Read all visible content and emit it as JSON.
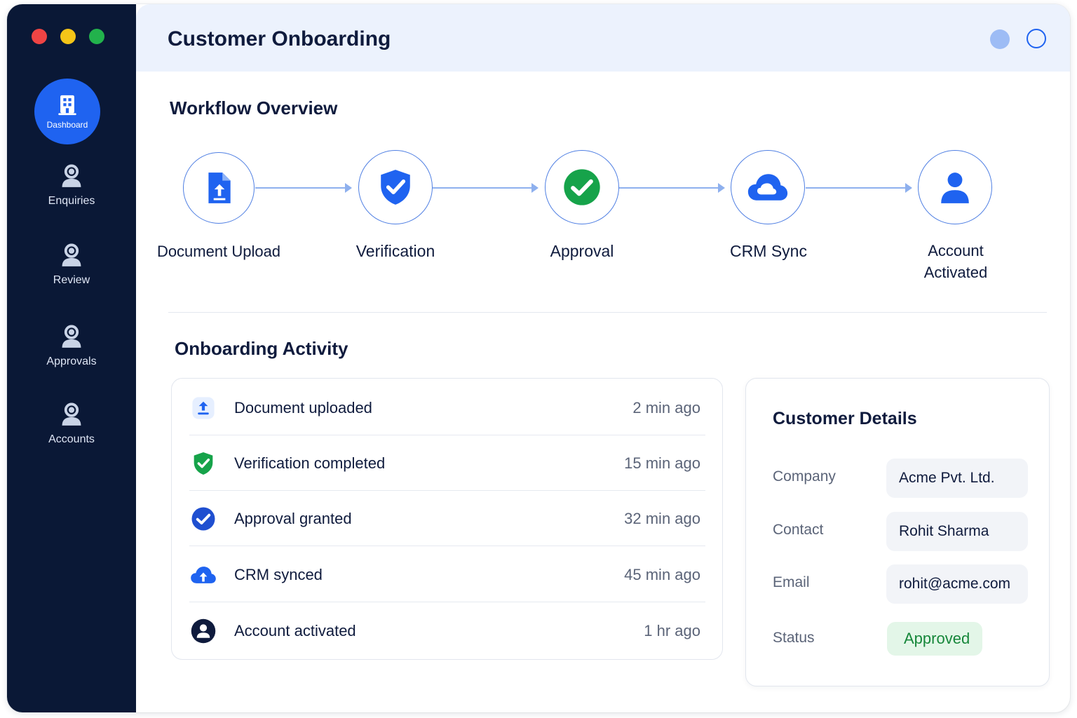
{
  "sidebar": {
    "items": [
      {
        "label": "Dashboard",
        "icon": "building-icon",
        "active": true
      },
      {
        "label": "Enquiries",
        "icon": "user-icon"
      },
      {
        "label": "Review",
        "icon": "user-icon"
      },
      {
        "label": "Approvals",
        "icon": "user-icon"
      },
      {
        "label": "Accounts",
        "icon": "user-icon"
      }
    ]
  },
  "header": {
    "title": "Customer Onboarding"
  },
  "workflow": {
    "title": "Workflow Overview",
    "steps": [
      {
        "label": "Document Upload",
        "icon": "document-upload-icon"
      },
      {
        "label": "Verification",
        "icon": "shield-check-icon"
      },
      {
        "label": "Approval",
        "icon": "check-circle-icon"
      },
      {
        "label": "CRM Sync",
        "icon": "cloud-icon"
      },
      {
        "label": "Account Activated",
        "icon": "user-icon"
      }
    ]
  },
  "activity": {
    "title": "Onboarding Activity",
    "items": [
      {
        "text": "Document uploaded",
        "time": "2 min ago",
        "icon": "upload-icon"
      },
      {
        "text": "Verification completed",
        "time": "15 min ago",
        "icon": "shield-check-icon"
      },
      {
        "text": "Approval granted",
        "time": "32 min ago",
        "icon": "check-circle-icon"
      },
      {
        "text": "CRM synced",
        "time": "45 min ago",
        "icon": "cloud-upload-icon"
      },
      {
        "text": "Account activated",
        "time": "1 hr ago",
        "icon": "user-circle-icon"
      }
    ]
  },
  "customer": {
    "title": "Customer Details",
    "fields": [
      {
        "label": "Company",
        "value": "Acme Pvt. Ltd."
      },
      {
        "label": "Contact",
        "value": "Rohit Sharma"
      },
      {
        "label": "Email",
        "value": "rohit@acme.com"
      },
      {
        "label": "Status",
        "value": "Approved"
      }
    ]
  },
  "colors": {
    "sidebar": "#0a1836",
    "accent": "#1f63f0",
    "success": "#16a34a",
    "header_bg": "#ecf2fd"
  }
}
